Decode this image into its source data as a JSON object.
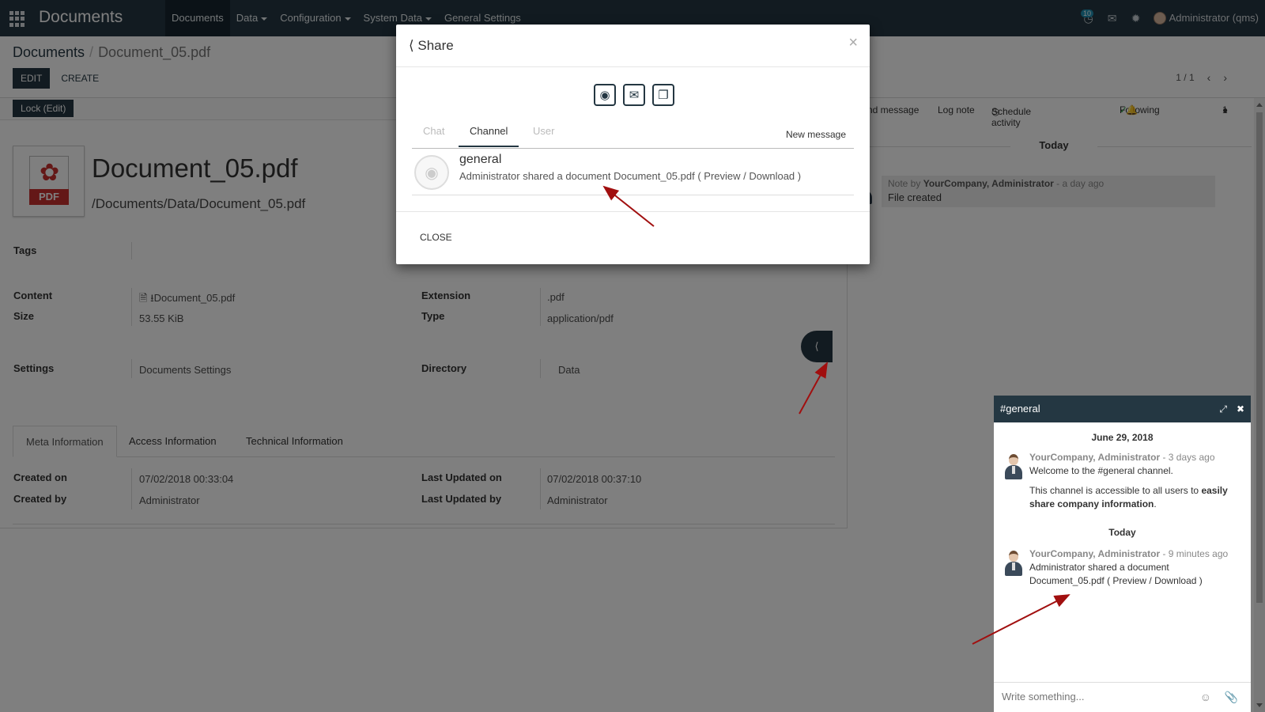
{
  "navbar": {
    "brand": "Documents",
    "menu": [
      {
        "label": "Documents",
        "dropdown": false
      },
      {
        "label": "Data",
        "dropdown": true
      },
      {
        "label": "Configuration",
        "dropdown": true
      },
      {
        "label": "System Data",
        "dropdown": true
      },
      {
        "label": "General Settings",
        "dropdown": false
      }
    ],
    "messages_badge": "10",
    "user": "Administrator (qms)"
  },
  "breadcrumb": {
    "parent": "Documents",
    "current": "Document_05.pdf"
  },
  "buttons": {
    "edit": "Edit",
    "create": "Create",
    "lock": "Lock (Edit)"
  },
  "pager": {
    "value": "1 / 1"
  },
  "document": {
    "badge": "PDF",
    "title": "Document_05.pdf",
    "path": "/Documents/Data/Document_05.pdf"
  },
  "fields": {
    "tags_label": "Tags",
    "content_label": "Content",
    "content_value": "Document_05.pdf",
    "size_label": "Size",
    "size_value": "53.55 KiB",
    "extension_label": "Extension",
    "extension_value": ".pdf",
    "type_label": "Type",
    "type_value": "application/pdf",
    "settings_label": "Settings",
    "settings_value": "Documents Settings",
    "directory_label": "Directory",
    "directory_value": "Data",
    "created_on_label": "Created on",
    "created_on_value": "07/02/2018 00:33:04",
    "created_by_label": "Created by",
    "created_by_value": "Administrator",
    "updated_on_label": "Last Updated on",
    "updated_on_value": "07/02/2018 00:37:10",
    "updated_by_label": "Last Updated by",
    "updated_by_value": "Administrator"
  },
  "tabs": [
    "Meta Information",
    "Access Information",
    "Technical Information"
  ],
  "chatter": {
    "send_message": "nd message",
    "log_note": "Log note",
    "schedule": "Schedule activity",
    "following": "Following",
    "followers": "1",
    "today": "Today",
    "note_prefix": "Note by",
    "note_author": "YourCompany, Administrator",
    "note_time": "- a day ago",
    "note_text": "File created"
  },
  "modal": {
    "title": "Share",
    "tabs": {
      "chat": "Chat",
      "channel": "Channel",
      "user": "User",
      "new_message": "New message"
    },
    "channel_name": "general",
    "channel_msg": "Administrator shared a document Document_05.pdf ( Preview / Download )",
    "close": "Close"
  },
  "chat_window": {
    "title": "#general",
    "date": "June 29, 2018",
    "msg1_author": "YourCompany, Administrator",
    "msg1_time": "- 3 days ago",
    "msg1_line1": "Welcome to the #general channel.",
    "msg1_line2a": "This channel is accessible to all users to ",
    "msg1_bold1": "easily share company information",
    "msg1_line2b": ".",
    "today": "Today",
    "msg2_author": "YourCompany, Administrator",
    "msg2_time": "- 9 minutes ago",
    "msg2_line1": "Administrator shared a document",
    "msg2_line2": "Document_05.pdf ( Preview / Download )",
    "composer_placeholder": "Write something..."
  },
  "colors": {
    "primary": "#243742",
    "pdf_red": "#c8312e",
    "arrow_red": "#a10f0f"
  }
}
